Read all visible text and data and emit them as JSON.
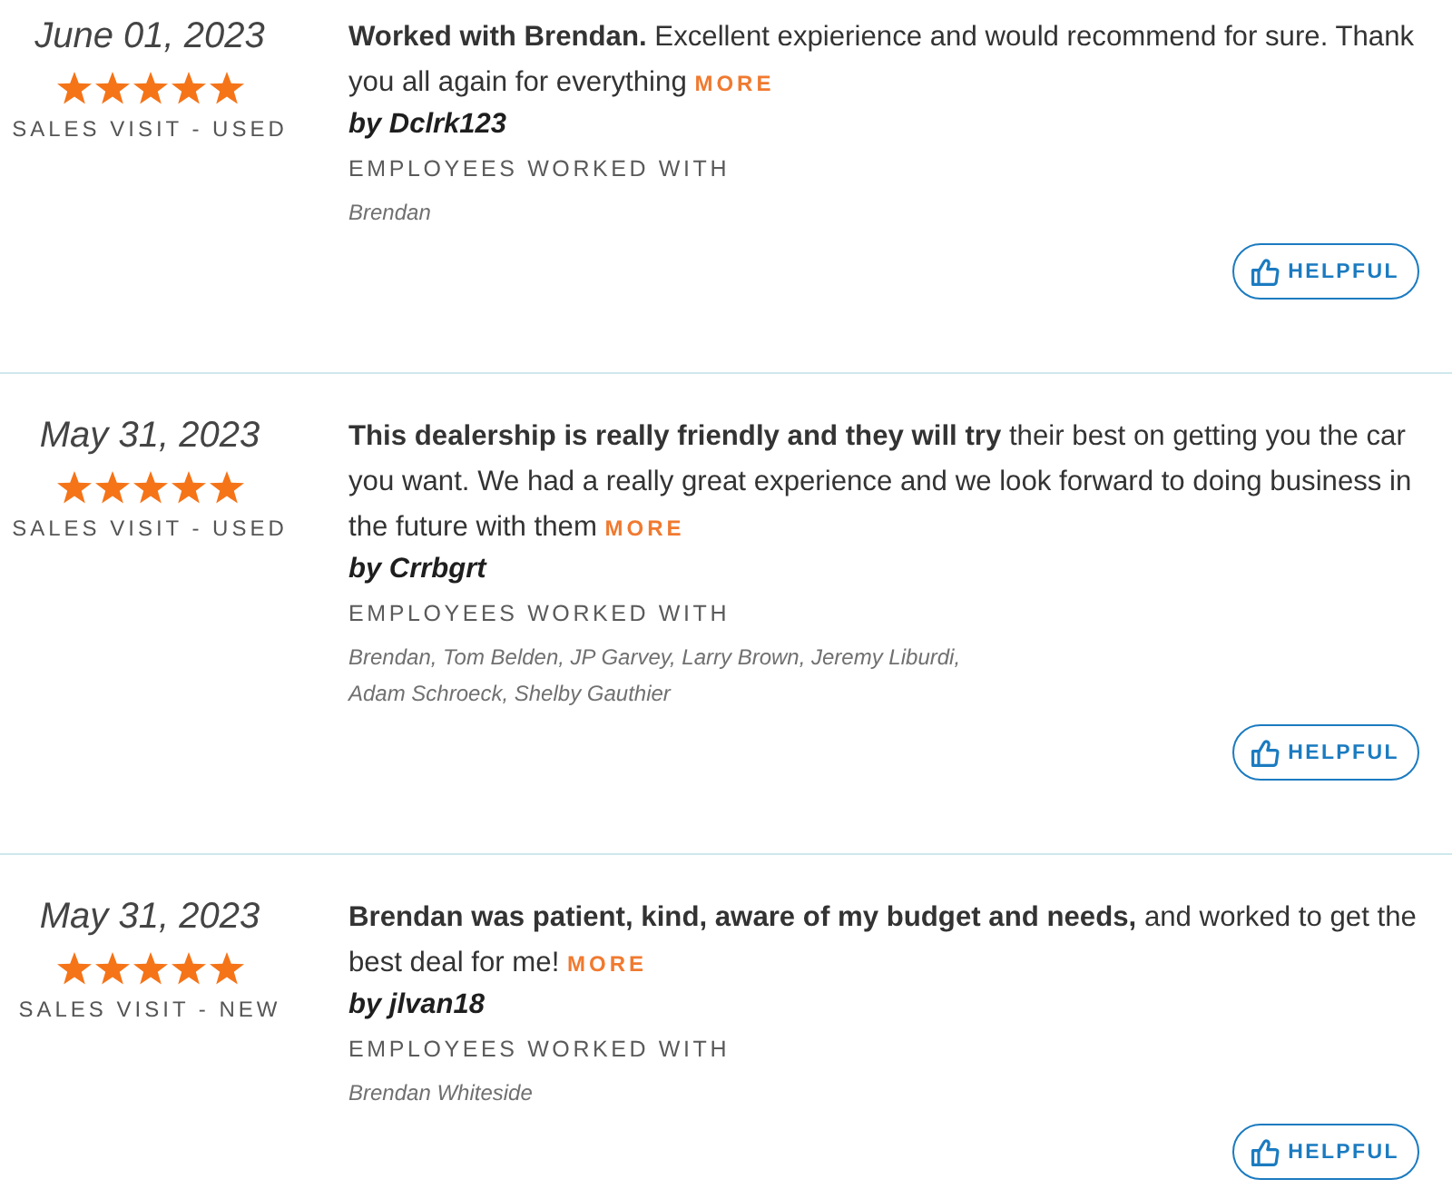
{
  "reviews": [
    {
      "date": "June 01, 2023",
      "stars": 5,
      "visit_type": "SALES VISIT - USED",
      "text": "**Worked with Brendan.** Excellent expierience and would recommend for sure. Thank you all again for everything",
      "more": "MORE",
      "author": "by Dclrk123",
      "employees_label": "EMPLOYEES WORKED WITH",
      "employees": "Brendan",
      "helpful": "HELPFUL"
    },
    {
      "date": "May 31, 2023",
      "stars": 5,
      "visit_type": "SALES VISIT - USED",
      "text": "**This dealership is really friendly and they will try** their best on getting you the car you want. We had a really great experience and we look forward to doing business in the future with them",
      "more": "MORE",
      "author": "by Crrbgrt",
      "employees_label": "EMPLOYEES WORKED WITH",
      "employees": "Brendan, Tom Belden, JP Garvey, Larry Brown, Jeremy Liburdi, Adam Schroeck, Shelby Gauthier",
      "helpful": "HELPFUL"
    },
    {
      "date": "May 31, 2023",
      "stars": 5,
      "visit_type": "SALES VISIT - NEW",
      "text": "**Brendan was patient, kind, aware of my budget and needs,** and worked to get the best deal for me!",
      "more": "MORE",
      "author": "by jlvan18",
      "employees_label": "EMPLOYEES WORKED WITH",
      "employees": "Brendan Whiteside",
      "helpful": "HELPFUL"
    }
  ]
}
